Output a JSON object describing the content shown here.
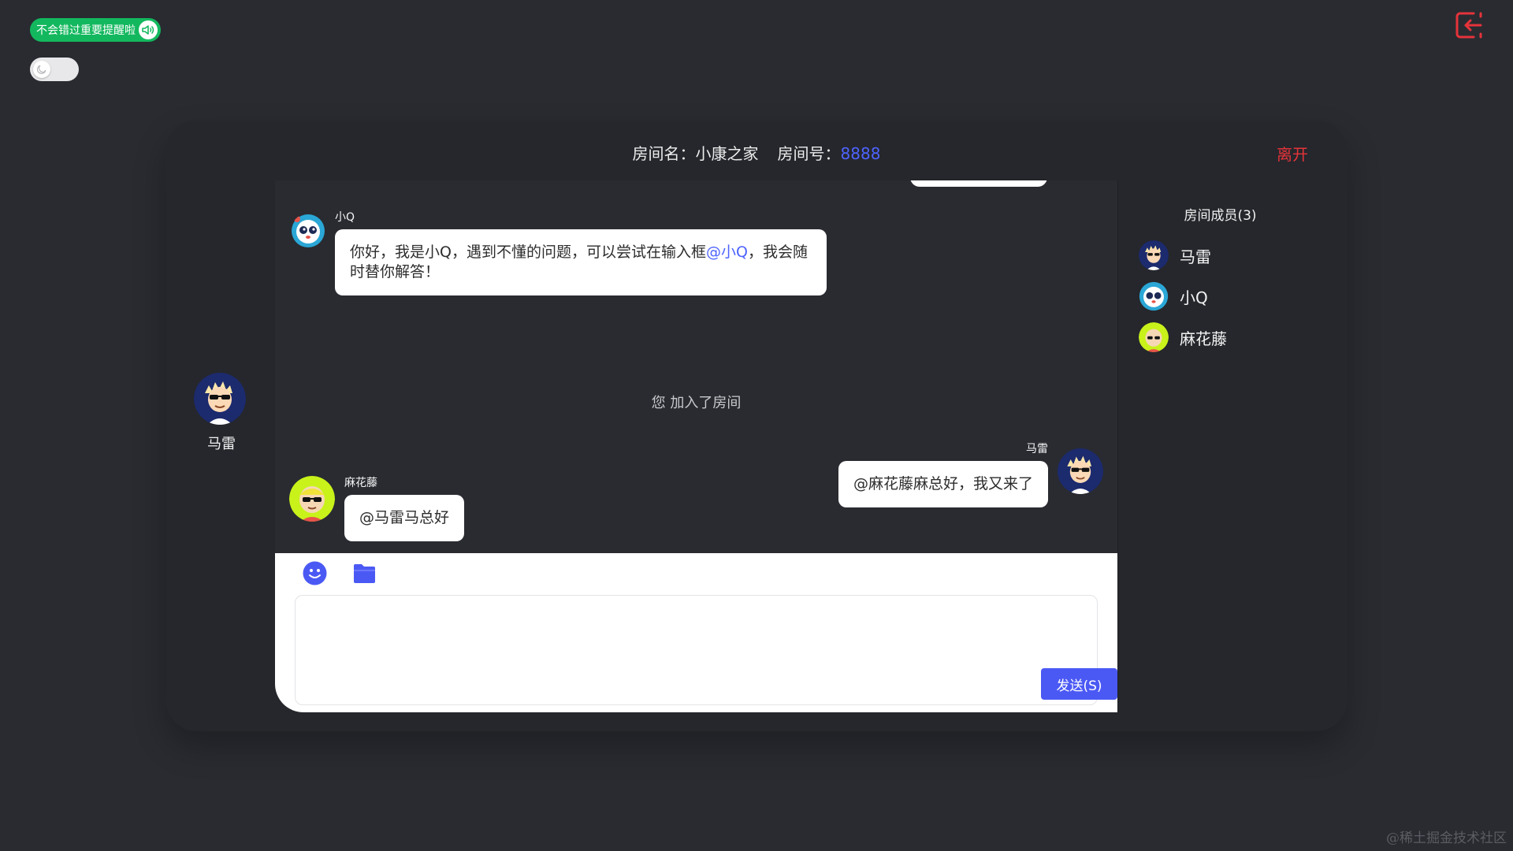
{
  "top_widgets": {
    "notify_label": "不会错过重要提醒啦",
    "notify_on": true,
    "dark_mode_on": false
  },
  "room": {
    "name_label": "房间名：",
    "name": "小康之家",
    "id_label": "房间号：",
    "id": "8888",
    "leave_label": "离开"
  },
  "self": {
    "name": "马雷"
  },
  "messages": [
    {
      "sender": "小Q",
      "text_before": "你好，我是小Q，遇到不懂的问题，可以尝试在输入框",
      "mention": "@小Q",
      "text_after": "，我会随时替你解答！"
    },
    {
      "system": "您 加入了房间"
    },
    {
      "sender": "马雷",
      "text": "@麻花藤麻总好，我又来了"
    },
    {
      "sender": "麻花藤",
      "text": "@马雷马总好"
    }
  ],
  "composer": {
    "input_value": "",
    "send_label": "发送(S)"
  },
  "members": {
    "title": "房间成员(3)",
    "items": [
      "马雷",
      "小Q",
      "麻花藤"
    ]
  },
  "colors": {
    "accent": "#4b59f4",
    "danger": "#e5333a",
    "toggle_on": "#13b85e"
  },
  "watermark": "@稀土掘金技术社区"
}
